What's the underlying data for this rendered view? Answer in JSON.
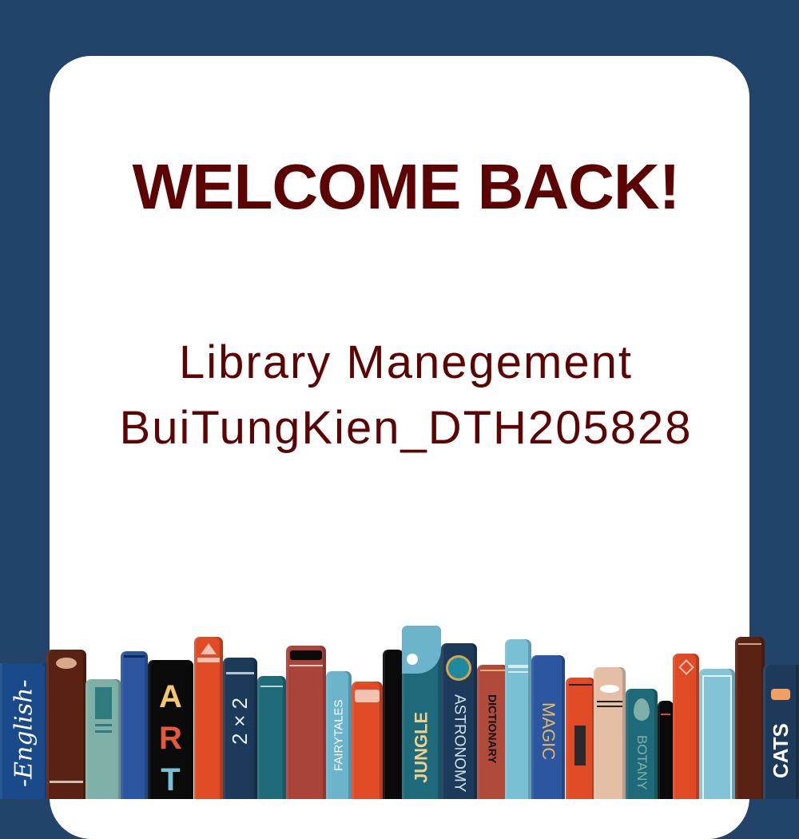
{
  "splash": {
    "title": "WELCOME BACK!",
    "subtitle_line1": "Library Manegement",
    "subtitle_line2": "BuiTungKien_DTH205828"
  },
  "colors": {
    "background": "#22436a",
    "card": "#ffffff",
    "text": "#5c0303"
  },
  "bookshelf": {
    "spine_labels": {
      "english": "-English-",
      "art": [
        "A",
        "R",
        "T"
      ],
      "math": "2×2",
      "fairytales": "FAIRYTALES",
      "jungle": "JUNGLE",
      "astronomy": "ASTRONOMY",
      "dictionary": "DICTIONARY",
      "magic": "MAGIC",
      "botany": "BOTANY",
      "cats": "CATS"
    }
  }
}
